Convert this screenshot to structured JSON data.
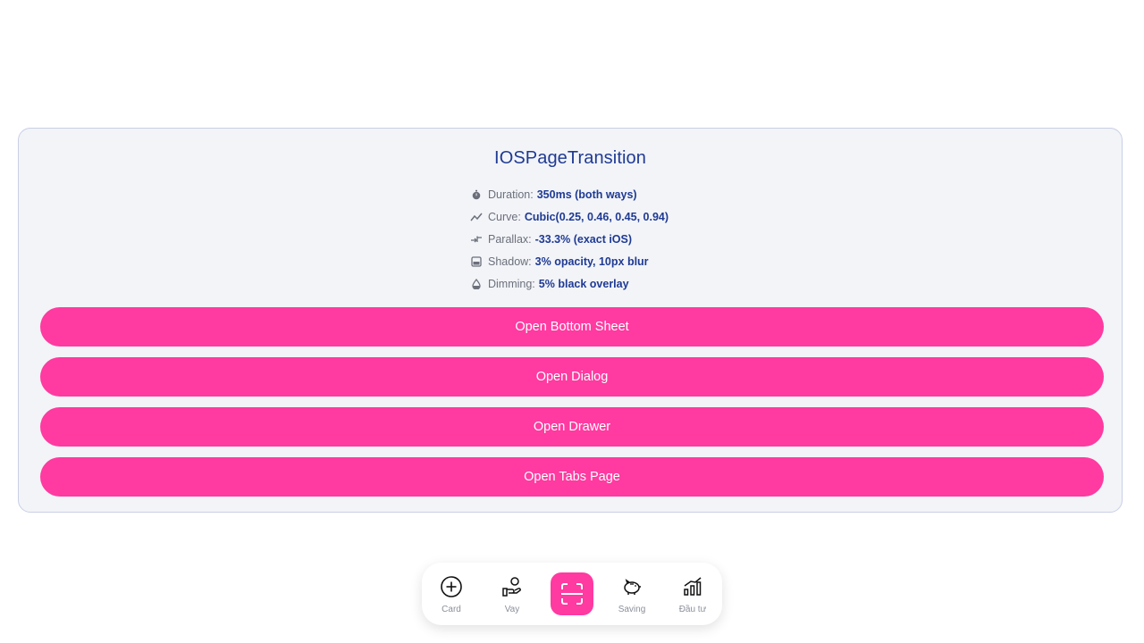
{
  "card": {
    "title": "IOSPageTransition",
    "rows": [
      {
        "icon": "stopwatch-icon",
        "label": "Duration:",
        "value": "350ms (both ways)"
      },
      {
        "icon": "trend-line-icon",
        "label": "Curve:",
        "value": "Cubic(0.25, 0.46, 0.45, 0.94)"
      },
      {
        "icon": "parallax-arrows-icon",
        "label": "Parallax:",
        "value": "-33.3% (exact iOS)"
      },
      {
        "icon": "image-shadow-icon",
        "label": "Shadow:",
        "value": "3% opacity, 10px blur"
      },
      {
        "icon": "drop-icon",
        "label": "Dimming:",
        "value": "5% black overlay"
      }
    ],
    "buttons": [
      {
        "label": "Open Bottom Sheet"
      },
      {
        "label": "Open Dialog"
      },
      {
        "label": "Open Drawer"
      },
      {
        "label": "Open Tabs Page"
      }
    ]
  },
  "navbar": {
    "items": [
      {
        "icon": "plus-circle-icon",
        "label": "Card"
      },
      {
        "icon": "hand-coin-icon",
        "label": "Vay"
      },
      {
        "icon": "scan-icon",
        "label": ""
      },
      {
        "icon": "piggy-bank-icon",
        "label": "Saving"
      },
      {
        "icon": "growth-chart-icon",
        "label": "Đầu tư"
      }
    ]
  },
  "colors": {
    "accent": "#ff3aa0",
    "title": "#1f3a93",
    "card_bg": "#f2f4f8",
    "card_border": "#c9cfe6"
  }
}
